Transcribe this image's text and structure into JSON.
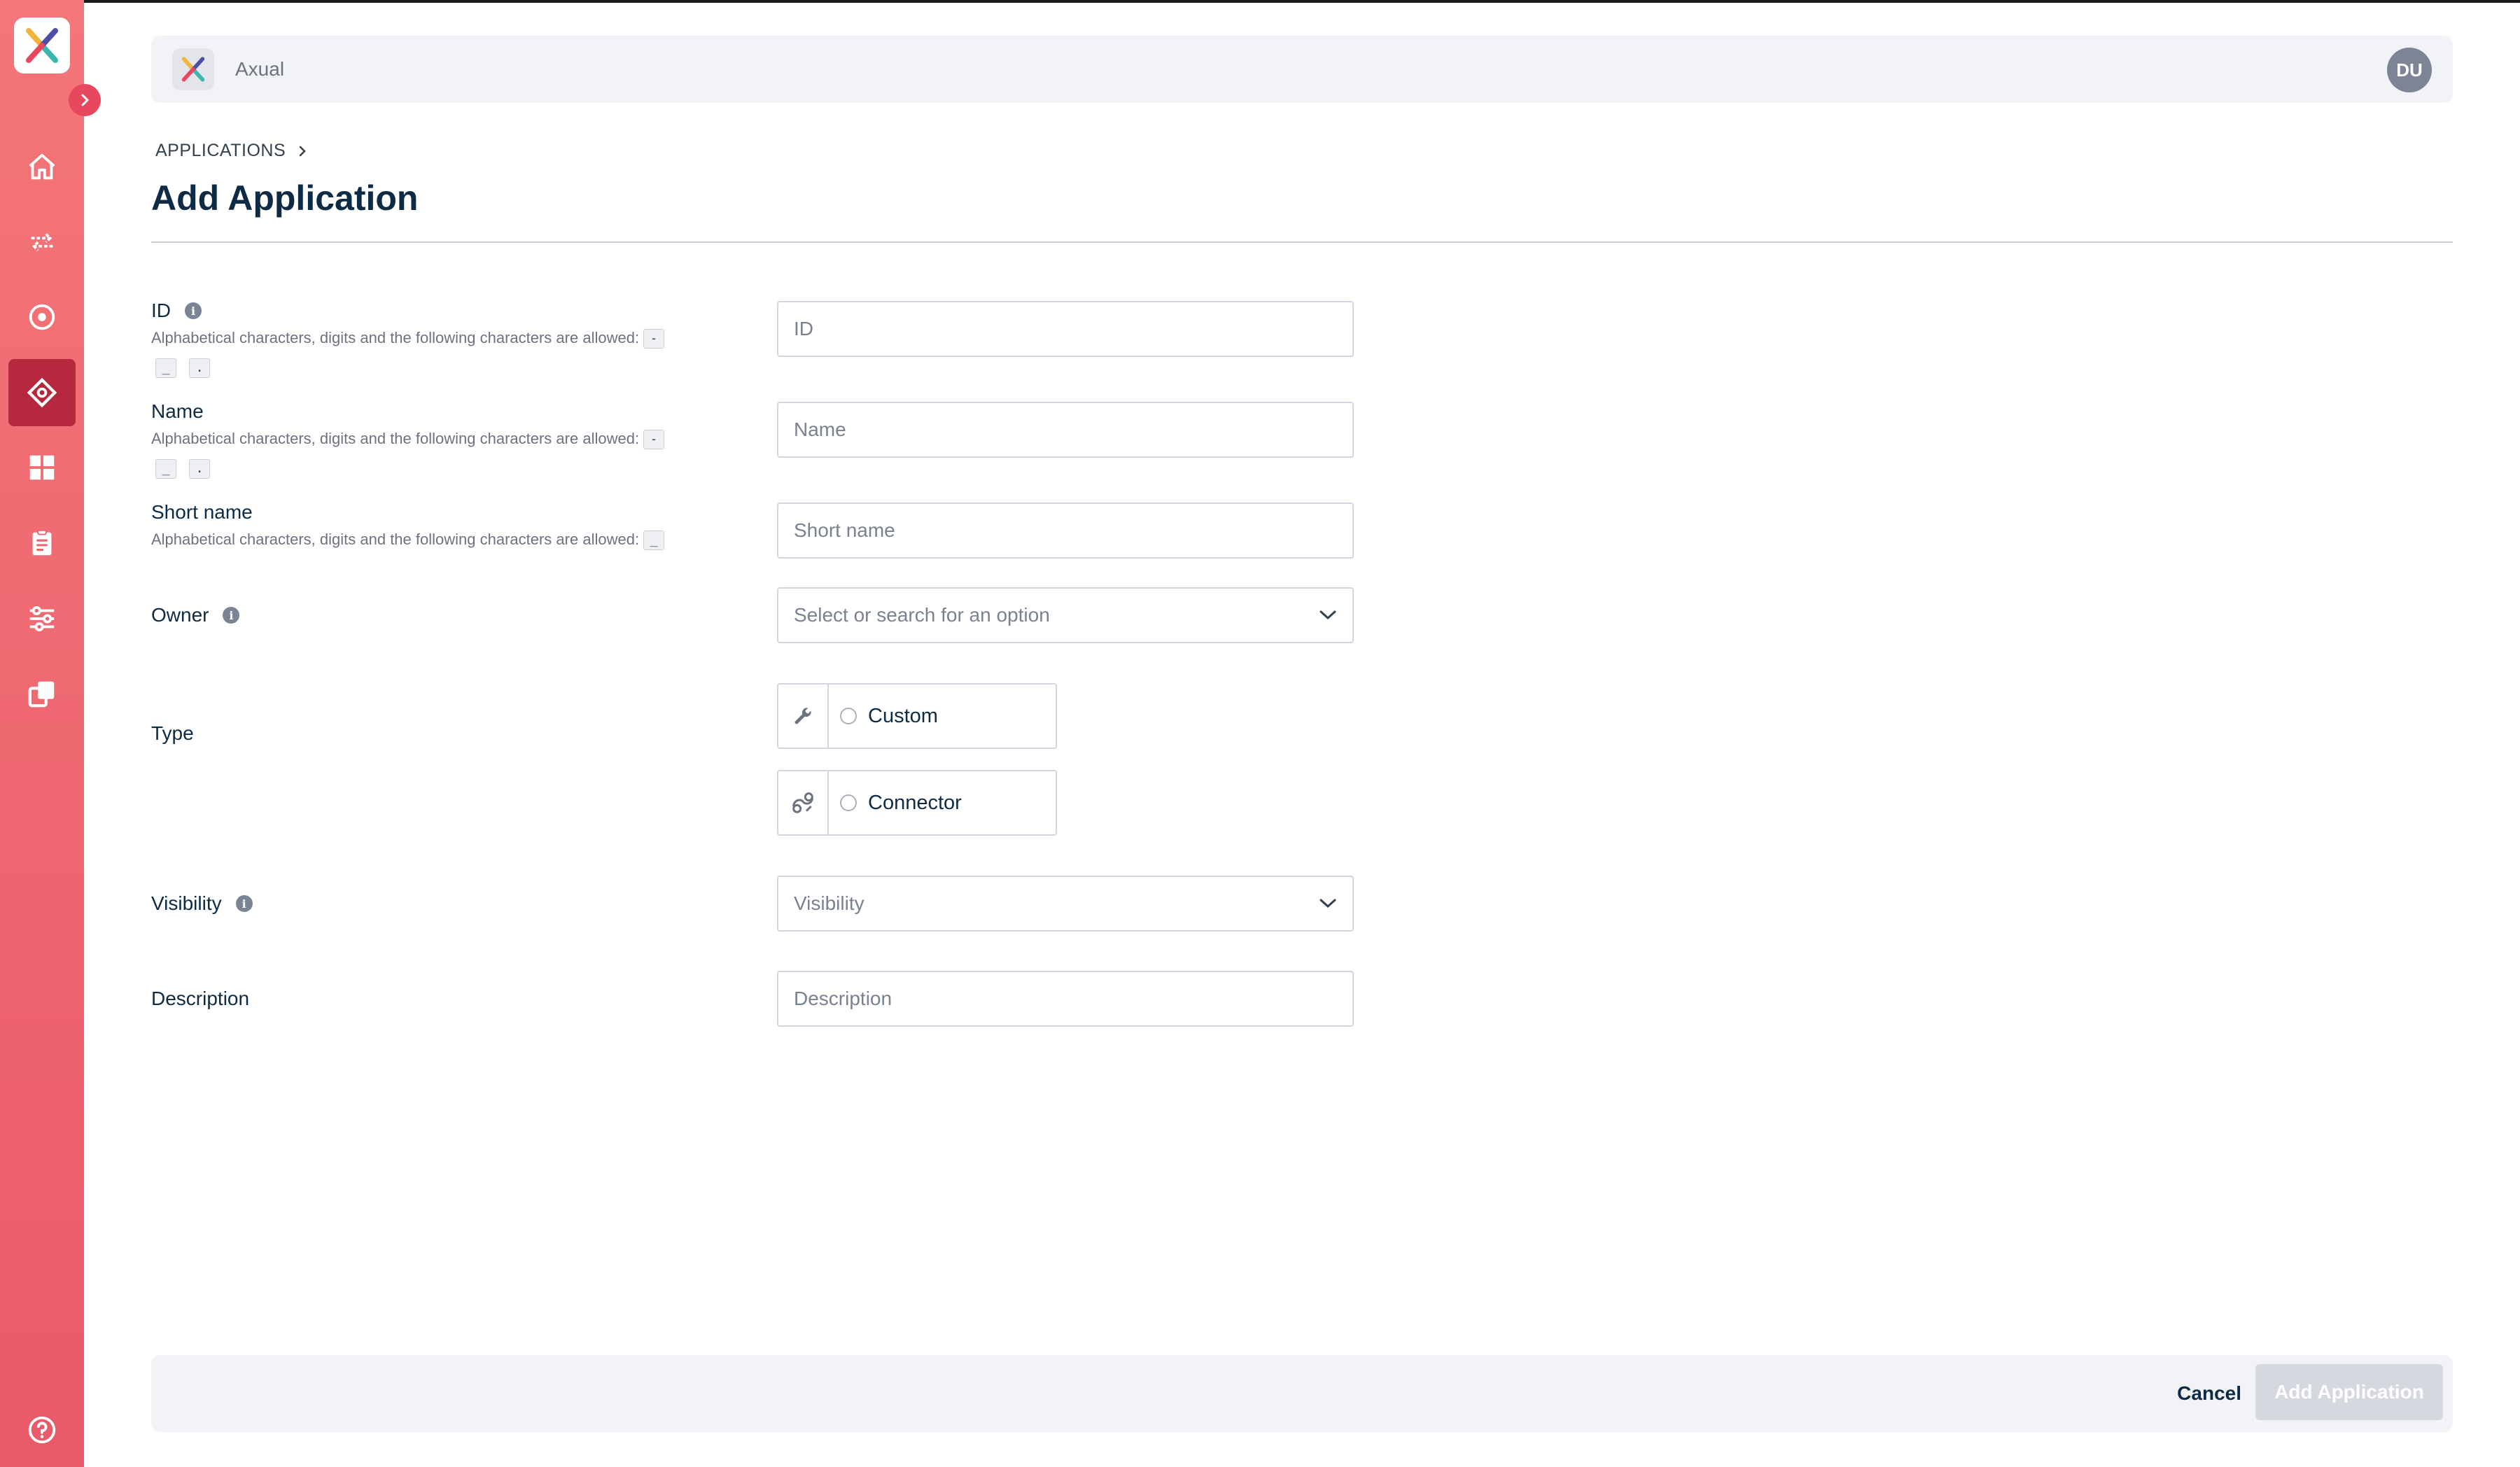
{
  "header": {
    "app_name": "Axual",
    "avatar_initials": "DU"
  },
  "breadcrumb": {
    "parent": "APPLICATIONS"
  },
  "page": {
    "title": "Add Application"
  },
  "form": {
    "id": {
      "label": "ID",
      "hint": "Alphabetical characters, digits and the following characters are allowed:",
      "allowed_chars": [
        "-",
        "_",
        "."
      ],
      "placeholder": "ID"
    },
    "name": {
      "label": "Name",
      "hint": "Alphabetical characters, digits and the following characters are allowed:",
      "allowed_chars": [
        "-",
        "_",
        "."
      ],
      "placeholder": "Name"
    },
    "short_name": {
      "label": "Short name",
      "hint": "Alphabetical characters, digits and the following characters are allowed:",
      "allowed_chars": [
        "_"
      ],
      "placeholder": "Short name"
    },
    "owner": {
      "label": "Owner",
      "placeholder": "Select or search for an option"
    },
    "type": {
      "label": "Type",
      "options": [
        "Custom",
        "Connector"
      ]
    },
    "visibility": {
      "label": "Visibility",
      "placeholder": "Visibility"
    },
    "description": {
      "label": "Description",
      "placeholder": "Description"
    }
  },
  "footer": {
    "cancel_label": "Cancel",
    "submit_label": "Add Application"
  },
  "sidebar": {
    "items": [
      {
        "icon": "home-icon"
      },
      {
        "icon": "streams-icon"
      },
      {
        "icon": "target-icon"
      },
      {
        "icon": "applications-icon",
        "active": true
      },
      {
        "icon": "dashboard-icon"
      },
      {
        "icon": "clipboard-icon"
      },
      {
        "icon": "settings-sliders-icon"
      },
      {
        "icon": "copy-icon"
      }
    ],
    "help_icon": "help-icon"
  },
  "colors": {
    "sidebar_top": "#f37678",
    "sidebar_bottom": "#ea5a69",
    "sidebar_active": "#b5283d",
    "title": "#0e2b45",
    "panel_bg": "#f2f3f6"
  }
}
